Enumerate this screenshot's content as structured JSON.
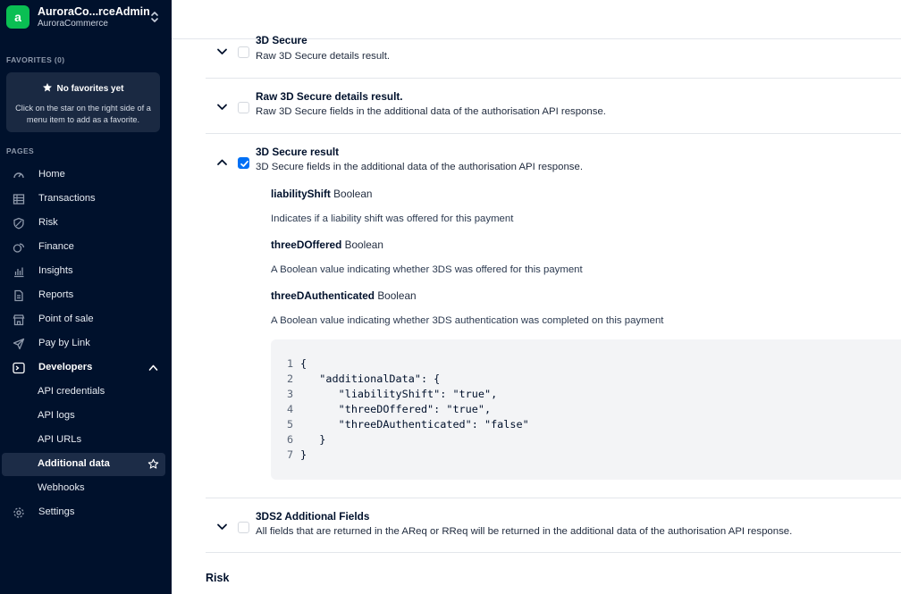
{
  "account": {
    "logo_letter": "a",
    "name": "AuroraCo...rceAdmin",
    "company": "AuroraCommerce"
  },
  "favorites": {
    "heading": "FAVORITES (0)",
    "empty_title": "No favorites yet",
    "empty_desc": "Click on the star on the right side of a menu item to add as a favorite."
  },
  "pages_heading": "PAGES",
  "nav": {
    "home": "Home",
    "transactions": "Transactions",
    "risk": "Risk",
    "finance": "Finance",
    "insights": "Insights",
    "reports": "Reports",
    "point_of_sale": "Point of sale",
    "pay_by_link": "Pay by Link",
    "developers": "Developers",
    "api_credentials": "API credentials",
    "api_logs": "API logs",
    "api_urls": "API URLs",
    "additional_data": "Additional data",
    "webhooks": "Webhooks",
    "settings": "Settings"
  },
  "rows": {
    "secure3d": {
      "title": "3D Secure",
      "desc": "Raw 3D Secure details result.",
      "checked": false
    },
    "raw3d": {
      "title": "Raw 3D Secure details result.",
      "desc": "Raw 3D Secure fields in the additional data of the authorisation API response.",
      "checked": false
    },
    "result3d": {
      "title": "3D Secure result",
      "desc": "3D Secure fields in the additional data of the authorisation API response.",
      "checked": true
    },
    "ds2": {
      "title": "3DS2 Additional Fields",
      "desc": "All fields that are returned in the AReq or RReq will be returned in the additional data of the authorisation API response.",
      "checked": false
    }
  },
  "fields": [
    {
      "name": "liabilityShift",
      "type": "Boolean",
      "desc": "Indicates if a liability shift was offered for this payment"
    },
    {
      "name": "threeDOffered",
      "type": "Boolean",
      "desc": "A Boolean value indicating whether 3DS was offered for this payment"
    },
    {
      "name": "threeDAuthenticated",
      "type": "Boolean",
      "desc": "A Boolean value indicating whether 3DS authentication was completed on this payment"
    }
  ],
  "code": [
    {
      "n": "1",
      "t": "{"
    },
    {
      "n": "2",
      "t": "   \"additionalData\": {"
    },
    {
      "n": "3",
      "t": "      \"liabilityShift\": \"true\","
    },
    {
      "n": "4",
      "t": "      \"threeDOffered\": \"true\","
    },
    {
      "n": "5",
      "t": "      \"threeDAuthenticated\": \"false\""
    },
    {
      "n": "6",
      "t": "   }"
    },
    {
      "n": "7",
      "t": "}"
    }
  ],
  "risk_heading": "Risk",
  "colors": {
    "sidebar_bg": "#00112c",
    "brand_green": "#0abf53",
    "checkbox_blue": "#0070f5"
  }
}
